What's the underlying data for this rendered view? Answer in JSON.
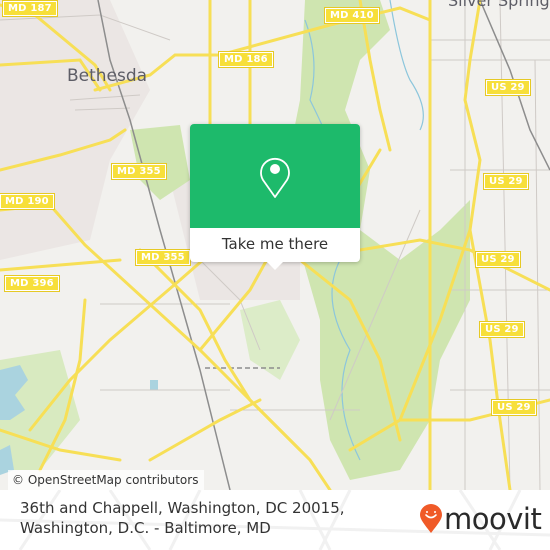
{
  "map": {
    "place_labels": [
      {
        "id": "bethesda",
        "text": "Bethesda"
      },
      {
        "id": "silver-spring",
        "text": "Silver Spring"
      }
    ],
    "route_shields": [
      {
        "id": "md187",
        "text": "MD 187"
      },
      {
        "id": "md410",
        "text": "MD 410"
      },
      {
        "id": "md186",
        "text": "MD 186"
      },
      {
        "id": "md355a",
        "text": "MD 355"
      },
      {
        "id": "md190",
        "text": "MD 190"
      },
      {
        "id": "md355b",
        "text": "MD 355"
      },
      {
        "id": "md396",
        "text": "MD 396"
      },
      {
        "id": "us29a",
        "text": "US 29"
      },
      {
        "id": "us29b",
        "text": "US 29"
      },
      {
        "id": "us29c",
        "text": "US 29"
      },
      {
        "id": "us29d",
        "text": "US 29"
      },
      {
        "id": "us29e",
        "text": "US 29"
      }
    ],
    "attribution": "© OpenStreetMap contributors",
    "colors": {
      "land": "#f2f1ee",
      "park": "#cfe5b0",
      "water": "#aad3df",
      "road": "#f7df56",
      "accent": "#1dba6b"
    }
  },
  "popup": {
    "icon": "map-pin-icon",
    "button_label": "Take me there"
  },
  "footer": {
    "address_line1": "36th and Chappell, Washington, DC 20015,",
    "address_line2": "Washington, D.C. - Baltimore, MD",
    "brand": "moovit",
    "brand_color": "#f05a28"
  }
}
